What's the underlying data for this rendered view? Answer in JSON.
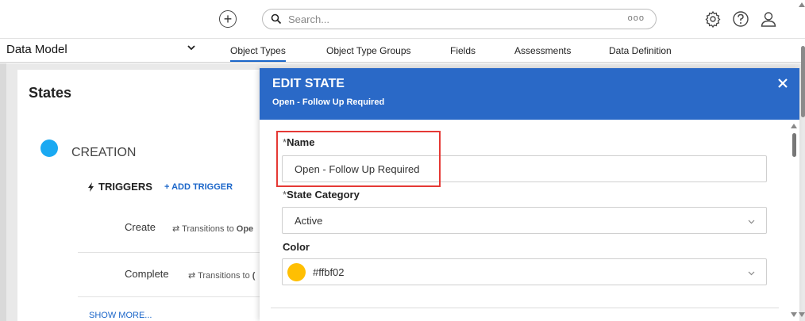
{
  "topbar": {
    "search_placeholder": "Search...",
    "search_more": "ooo",
    "icons": [
      "plus-circle-icon",
      "search-icon",
      "gear-icon",
      "help-icon",
      "user-icon"
    ]
  },
  "nav": {
    "selector_value": "Data Model",
    "tabs": [
      {
        "label": "Object Types",
        "active": true
      },
      {
        "label": "Object Type Groups",
        "active": false
      },
      {
        "label": "Fields",
        "active": false
      },
      {
        "label": "Assessments",
        "active": false
      },
      {
        "label": "Data Definition",
        "active": false
      }
    ]
  },
  "states": {
    "title": "States",
    "state_name": "CREATION",
    "state_color": "#1aa9f2",
    "triggers_label": "TRIGGERS",
    "add_trigger_label": "+ ADD TRIGGER",
    "triggers": [
      {
        "name": "Create",
        "transition": "⇄ Transitions to",
        "target": "Ope"
      },
      {
        "name": "Complete",
        "transition": "⇄ Transitions to",
        "target": "("
      }
    ],
    "show_more_label": "SHOW MORE..."
  },
  "edit_panel": {
    "title": "EDIT STATE",
    "subtitle": "Open - Follow Up Required",
    "name_label": "Name",
    "name_value": "Open - Follow Up Required",
    "category_label": "State Category",
    "category_value": "Active",
    "color_label": "Color",
    "color_value": "#ffbf02",
    "required_mark": "*",
    "header_color": "#2a69c7",
    "highlight_color": "#e53935"
  }
}
